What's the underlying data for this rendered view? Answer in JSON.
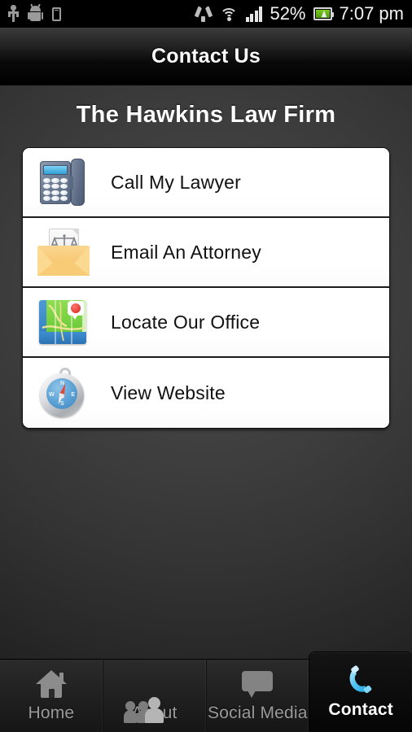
{
  "statusbar": {
    "left_icons": [
      "usb-icon",
      "android-robot-icon",
      "sd-card-icon"
    ],
    "right_icons": [
      "sync-icon",
      "wifi-icon",
      "signal-bars-icon",
      "battery-charging-icon"
    ],
    "battery_percent": "52%",
    "time": "7:07 pm"
  },
  "titlebar": {
    "title": "Contact Us"
  },
  "main": {
    "heading": "The Hawkins Law Firm",
    "items": [
      {
        "label": "Call My Lawyer",
        "icon": "desk-phone-icon"
      },
      {
        "label": "Email An Attorney",
        "icon": "envelope-scales-icon"
      },
      {
        "label": "Locate Our Office",
        "icon": "map-pin-icon"
      },
      {
        "label": "View Website",
        "icon": "compass-icon"
      }
    ]
  },
  "tabbar": {
    "tabs": [
      {
        "label": "Home",
        "icon": "home-icon",
        "active": false
      },
      {
        "label": "About",
        "icon": "people-icon",
        "active": false
      },
      {
        "label": "Social Media",
        "icon": "chat-icon",
        "active": false
      },
      {
        "label": "Contact",
        "icon": "handset-icon",
        "active": true
      }
    ]
  },
  "colors": {
    "accent_blue": "#4fc3f7",
    "battery_green": "#7bc81e",
    "card_white": "#ffffff",
    "background_dark": "#3e3e3e",
    "tab_inactive": "#9a9a9a"
  }
}
